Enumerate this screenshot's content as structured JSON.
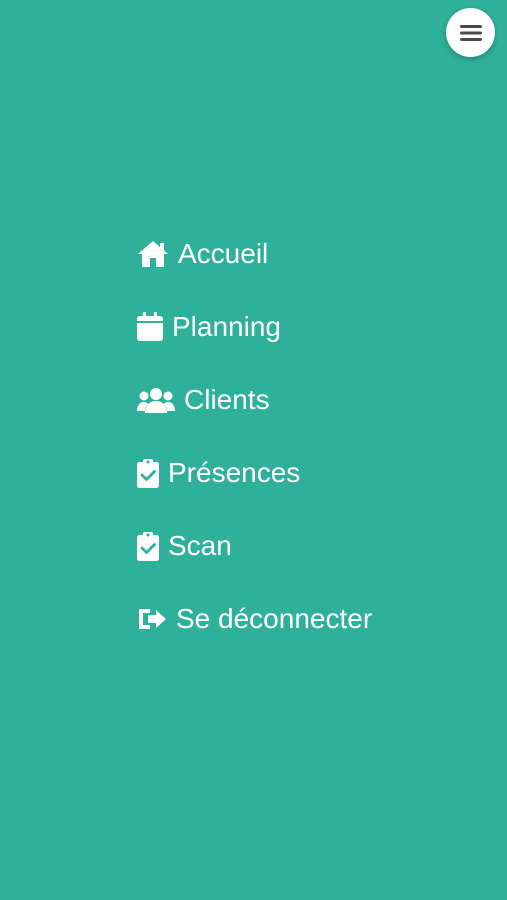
{
  "theme": {
    "background": "#2fb09a",
    "text": "#ffffff",
    "toggle_background": "#ffffff",
    "toggle_icon": "#4a4a4a"
  },
  "menu_toggle": {
    "icon": "hamburger-icon"
  },
  "nav": {
    "items": [
      {
        "label": "Accueil",
        "icon": "home-icon"
      },
      {
        "label": "Planning",
        "icon": "calendar-icon"
      },
      {
        "label": "Clients",
        "icon": "users-icon"
      },
      {
        "label": "Présences",
        "icon": "clipboard-check-icon"
      },
      {
        "label": "Scan",
        "icon": "clipboard-check-icon"
      },
      {
        "label": "Se déconnecter",
        "icon": "sign-out-icon"
      }
    ]
  }
}
